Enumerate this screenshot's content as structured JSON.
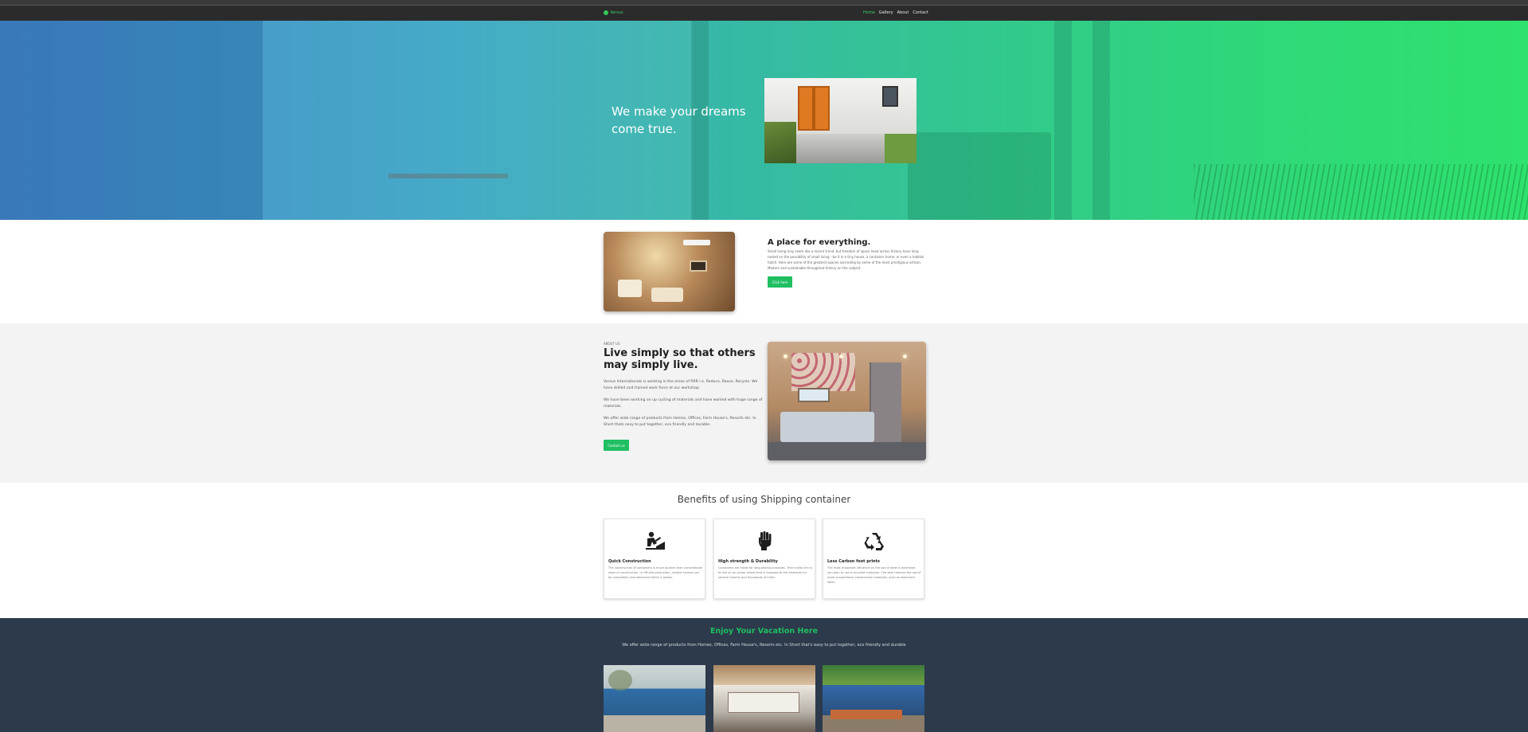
{
  "colors": {
    "accent": "#1fbf62",
    "navbar_bg": "#2b2b2b",
    "footer_bg": "#2c3a4b"
  },
  "navbar": {
    "brand_icon": "leaf-logo-icon",
    "brand_text": "Versus",
    "links": [
      {
        "label": "Home",
        "active": true
      },
      {
        "label": "Gallery",
        "active": false
      },
      {
        "label": "About",
        "active": false
      },
      {
        "label": "Contact",
        "active": false
      }
    ]
  },
  "hero": {
    "headline": "We make your dreams come true."
  },
  "place": {
    "title": "A place for everything.",
    "body": "Small living may seem like a recent trend, but freedom of space lived across history have long rooted on the possibility of small living - be it in a tiny house, a container home, or even a habitat hatch. Here are some of the greatest spaces ascending by some of the most prestigious artisan. Modern and sustainable throughout history on the subject.",
    "button": "Click here"
  },
  "about": {
    "eyebrow": "ABOUT US",
    "title": "Live simply so that others may simply live.",
    "p1": "Versus Internationals is working in the areas of RRR i.e. Reduce, Reuse, Recycle. We have skilled and trained work force at our workshop.",
    "p2": "We have been working on up cycling of materials and have worked with huge range of materials.",
    "p3": "We offer wide range of products from Homes, Offices, Farm House's, Resorts etc. In Short thats easy to put together, eco friendly and durable.",
    "button": "Contact us"
  },
  "benefits": {
    "title": "Benefits of using Shipping container",
    "cards": [
      {
        "icon": "construction-worker-icon",
        "title": "Quick Construction",
        "text": "The construction of containers is much quicker than conventional ways of construction. In Off-site production, smaller homes can be completely manufactured within 2 weeks."
      },
      {
        "icon": "raised-fist-icon",
        "title": "High strength & Durability",
        "text": "Containers are made for long-lasting purposes. Their initial aim is to live on an ocean vessel that is exposed to the elements for several months and thousands of miles."
      },
      {
        "icon": "recycle-icon",
        "title": "Less Carbon foot prints",
        "text": "The most important influence on the use of steel is whenever you plan to use a recycled container. The deal reduces the use of more conventional construction materials, such as wood and steel."
      }
    ]
  },
  "vacation": {
    "title": "Enjoy Your Vacation Here",
    "subtitle": "We offer wide range of products from Homes, Offices, Farm House's, Resorts etc. In Short that's easy to put together, eco friendly and durable"
  }
}
